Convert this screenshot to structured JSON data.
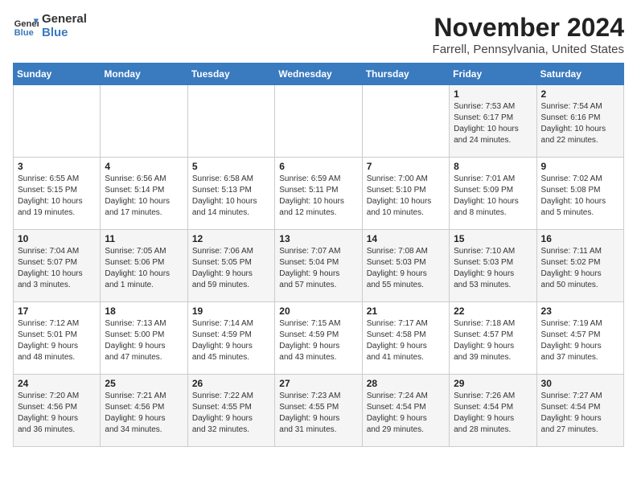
{
  "header": {
    "logo_line1": "General",
    "logo_line2": "Blue",
    "month": "November 2024",
    "location": "Farrell, Pennsylvania, United States"
  },
  "weekdays": [
    "Sunday",
    "Monday",
    "Tuesday",
    "Wednesday",
    "Thursday",
    "Friday",
    "Saturday"
  ],
  "weeks": [
    [
      {
        "day": "",
        "info": ""
      },
      {
        "day": "",
        "info": ""
      },
      {
        "day": "",
        "info": ""
      },
      {
        "day": "",
        "info": ""
      },
      {
        "day": "",
        "info": ""
      },
      {
        "day": "1",
        "info": "Sunrise: 7:53 AM\nSunset: 6:17 PM\nDaylight: 10 hours\nand 24 minutes."
      },
      {
        "day": "2",
        "info": "Sunrise: 7:54 AM\nSunset: 6:16 PM\nDaylight: 10 hours\nand 22 minutes."
      }
    ],
    [
      {
        "day": "3",
        "info": "Sunrise: 6:55 AM\nSunset: 5:15 PM\nDaylight: 10 hours\nand 19 minutes."
      },
      {
        "day": "4",
        "info": "Sunrise: 6:56 AM\nSunset: 5:14 PM\nDaylight: 10 hours\nand 17 minutes."
      },
      {
        "day": "5",
        "info": "Sunrise: 6:58 AM\nSunset: 5:13 PM\nDaylight: 10 hours\nand 14 minutes."
      },
      {
        "day": "6",
        "info": "Sunrise: 6:59 AM\nSunset: 5:11 PM\nDaylight: 10 hours\nand 12 minutes."
      },
      {
        "day": "7",
        "info": "Sunrise: 7:00 AM\nSunset: 5:10 PM\nDaylight: 10 hours\nand 10 minutes."
      },
      {
        "day": "8",
        "info": "Sunrise: 7:01 AM\nSunset: 5:09 PM\nDaylight: 10 hours\nand 8 minutes."
      },
      {
        "day": "9",
        "info": "Sunrise: 7:02 AM\nSunset: 5:08 PM\nDaylight: 10 hours\nand 5 minutes."
      }
    ],
    [
      {
        "day": "10",
        "info": "Sunrise: 7:04 AM\nSunset: 5:07 PM\nDaylight: 10 hours\nand 3 minutes."
      },
      {
        "day": "11",
        "info": "Sunrise: 7:05 AM\nSunset: 5:06 PM\nDaylight: 10 hours\nand 1 minute."
      },
      {
        "day": "12",
        "info": "Sunrise: 7:06 AM\nSunset: 5:05 PM\nDaylight: 9 hours\nand 59 minutes."
      },
      {
        "day": "13",
        "info": "Sunrise: 7:07 AM\nSunset: 5:04 PM\nDaylight: 9 hours\nand 57 minutes."
      },
      {
        "day": "14",
        "info": "Sunrise: 7:08 AM\nSunset: 5:03 PM\nDaylight: 9 hours\nand 55 minutes."
      },
      {
        "day": "15",
        "info": "Sunrise: 7:10 AM\nSunset: 5:03 PM\nDaylight: 9 hours\nand 53 minutes."
      },
      {
        "day": "16",
        "info": "Sunrise: 7:11 AM\nSunset: 5:02 PM\nDaylight: 9 hours\nand 50 minutes."
      }
    ],
    [
      {
        "day": "17",
        "info": "Sunrise: 7:12 AM\nSunset: 5:01 PM\nDaylight: 9 hours\nand 48 minutes."
      },
      {
        "day": "18",
        "info": "Sunrise: 7:13 AM\nSunset: 5:00 PM\nDaylight: 9 hours\nand 47 minutes."
      },
      {
        "day": "19",
        "info": "Sunrise: 7:14 AM\nSunset: 4:59 PM\nDaylight: 9 hours\nand 45 minutes."
      },
      {
        "day": "20",
        "info": "Sunrise: 7:15 AM\nSunset: 4:59 PM\nDaylight: 9 hours\nand 43 minutes."
      },
      {
        "day": "21",
        "info": "Sunrise: 7:17 AM\nSunset: 4:58 PM\nDaylight: 9 hours\nand 41 minutes."
      },
      {
        "day": "22",
        "info": "Sunrise: 7:18 AM\nSunset: 4:57 PM\nDaylight: 9 hours\nand 39 minutes."
      },
      {
        "day": "23",
        "info": "Sunrise: 7:19 AM\nSunset: 4:57 PM\nDaylight: 9 hours\nand 37 minutes."
      }
    ],
    [
      {
        "day": "24",
        "info": "Sunrise: 7:20 AM\nSunset: 4:56 PM\nDaylight: 9 hours\nand 36 minutes."
      },
      {
        "day": "25",
        "info": "Sunrise: 7:21 AM\nSunset: 4:56 PM\nDaylight: 9 hours\nand 34 minutes."
      },
      {
        "day": "26",
        "info": "Sunrise: 7:22 AM\nSunset: 4:55 PM\nDaylight: 9 hours\nand 32 minutes."
      },
      {
        "day": "27",
        "info": "Sunrise: 7:23 AM\nSunset: 4:55 PM\nDaylight: 9 hours\nand 31 minutes."
      },
      {
        "day": "28",
        "info": "Sunrise: 7:24 AM\nSunset: 4:54 PM\nDaylight: 9 hours\nand 29 minutes."
      },
      {
        "day": "29",
        "info": "Sunrise: 7:26 AM\nSunset: 4:54 PM\nDaylight: 9 hours\nand 28 minutes."
      },
      {
        "day": "30",
        "info": "Sunrise: 7:27 AM\nSunset: 4:54 PM\nDaylight: 9 hours\nand 27 minutes."
      }
    ]
  ]
}
